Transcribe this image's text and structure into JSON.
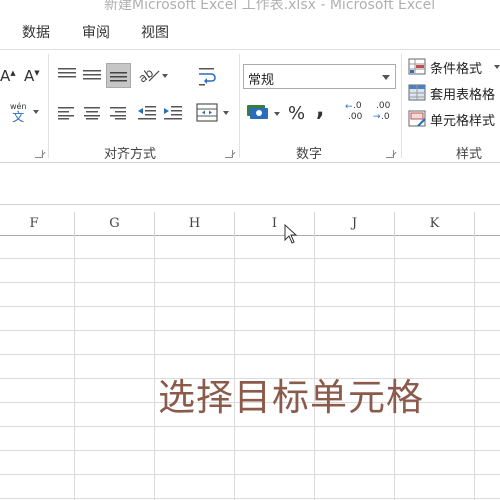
{
  "window": {
    "title": "新建Microsoft Excel 工作表.xlsx - Microsoft Excel"
  },
  "ribbon_tabs": [
    "数据",
    "审阅",
    "视图"
  ],
  "ribbon": {
    "groups": {
      "alignment": "对齐方式",
      "number": "数字",
      "styles": "样式"
    },
    "number_format": "常规",
    "phonetic_label": "wén",
    "phonetic_char": "文",
    "percent_symbol": "%",
    "comma_symbol": ",",
    "decimal_increase": ".00",
    "decimal_decrease": ".0",
    "font_grow": "A",
    "font_shrink": "A",
    "styles_items": [
      "条件格式",
      "套用表格格",
      "单元格样式"
    ]
  },
  "sheet": {
    "columns": [
      "F",
      "G",
      "H",
      "I",
      "J",
      "K"
    ]
  },
  "overlay_text": "选择目标单元格"
}
